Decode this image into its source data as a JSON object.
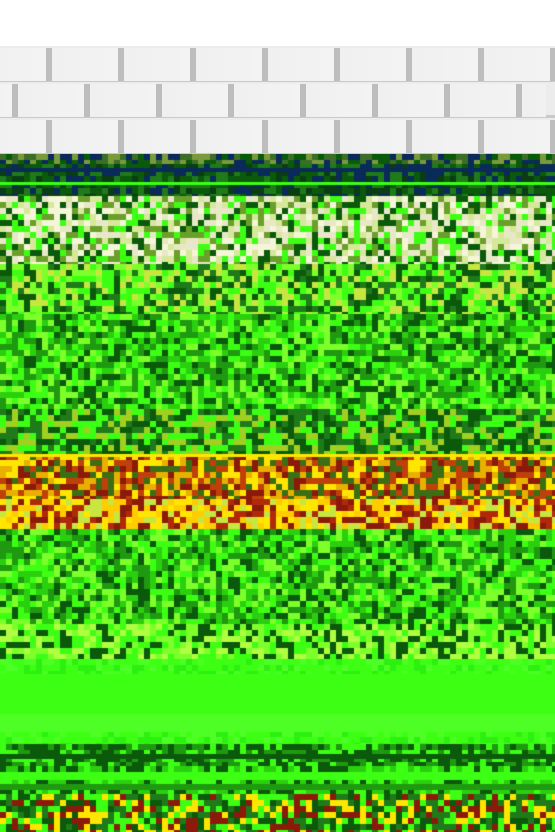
{
  "image": {
    "subject": "tulip-field-photo",
    "colors": {
      "background": "#ffffff",
      "brick": "#f0f0f0",
      "mortar": "#c4c4c4",
      "dark_green": "#0b5a0b",
      "bright_green": "#3cff14",
      "lime": "#7dff2a",
      "yellow": "#ffe600",
      "red": "#8c1a0a",
      "navy": "#0a2a5a"
    }
  }
}
